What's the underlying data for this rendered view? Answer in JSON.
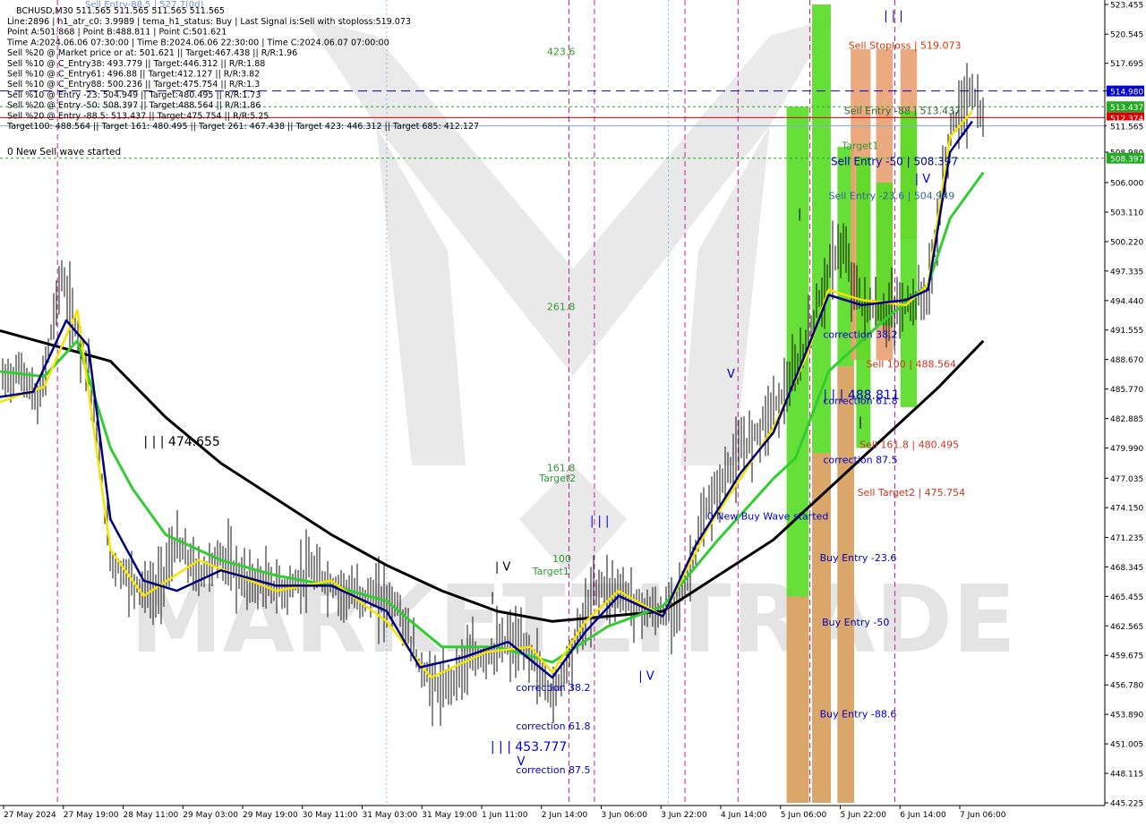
{
  "header": {
    "symbol_line": "BCHUSD,M30  511.565 511.565 511.565 511.565",
    "faded_line": "Sell Entry-88.5 | 527.7(0d)",
    "info_lines": [
      "Line:2896  |  h1_atr_c0: 3.9989  |  tema_h1_status: Buy  |  Last Signal is:Sell with stoploss:519.073",
      "Point A:501.868  |  Point B:488.811  |  Point C:501.621",
      "Time A:2024.06.06 07:30:00  |  Time B:2024.06.06 22:30:00  |  Time C:2024.06.07 07:00:00",
      "Sell %20 @ Market price or at: 501.621  ||  Target:467.438  ||  R/R:1.96",
      "Sell %10 @ C_Entry38: 493.779  ||  Target:446.312  ||  R/R:1.88",
      "Sell %10 @ C_Entry61: 496.88  ||  Target:412.127  ||  R/R:3.82",
      "Sell %10 @ C_Entry88: 500.236  ||  Target:475.754  ||  R/R:1.3",
      "Sell %10 @ Entry -23: 504.949  ||  Target:480.495  ||  R/R:1.73",
      "Sell %20 @ Entry -50: 508.397  ||  Target:488.564  ||  R/R:1.86",
      "Sell %20 @ Entry -88.5: 513.437  ||  Target:475.754  ||  R/R:5.25",
      "Target100: 488.564  ||  Target 161: 480.495  ||  Target 261: 467.438  ||  Target 423: 446.312  ||  Target 685: 412.127"
    ],
    "wave_status": "0 New Sell wave started"
  },
  "watermark": "MARKETZITRADE",
  "chart_data": {
    "type": "line",
    "symbol": "BCHUSD",
    "timeframe": "M30",
    "ylim": [
      445.225,
      523.455
    ],
    "y_ticks": [
      "523.455",
      "520.545",
      "517.695",
      "514.980",
      "511.565",
      "508.980",
      "506.000",
      "503.110",
      "500.220",
      "497.335",
      "494.440",
      "491.555",
      "488.670",
      "485.770",
      "482.885",
      "479.990",
      "477.035",
      "474.150",
      "471.235",
      "468.345",
      "465.455",
      "462.565",
      "459.675",
      "456.780",
      "453.890",
      "451.005",
      "448.115",
      "445.225"
    ],
    "x_ticks": [
      "27 May 2024",
      "27 May 19:00",
      "28 May 11:00",
      "29 May 03:00",
      "29 May 19:00",
      "30 May 11:00",
      "31 May 03:00",
      "31 May 19:00",
      "1 Jun 11:00",
      "2 Jun 14:00",
      "3 Jun 06:00",
      "3 Jun 22:00",
      "4 Jun 14:00",
      "5 Jun 06:00",
      "5 Jun 22:00",
      "6 Jun 14:00",
      "7 Jun 06:00"
    ],
    "price_path": [
      [
        0,
        486.5
      ],
      [
        0.02,
        487.5
      ],
      [
        0.035,
        484.0
      ],
      [
        0.055,
        497.0
      ],
      [
        0.065,
        493.0
      ],
      [
        0.08,
        488.0
      ],
      [
        0.1,
        469.0
      ],
      [
        0.12,
        467.0
      ],
      [
        0.14,
        465.5
      ],
      [
        0.16,
        470.5
      ],
      [
        0.18,
        467.5
      ],
      [
        0.2,
        469.5
      ],
      [
        0.22,
        467.0
      ],
      [
        0.24,
        466.5
      ],
      [
        0.26,
        466.0
      ],
      [
        0.28,
        468.0
      ],
      [
        0.3,
        466.5
      ],
      [
        0.32,
        465.5
      ],
      [
        0.34,
        465.5
      ],
      [
        0.36,
        464.5
      ],
      [
        0.38,
        458.5
      ],
      [
        0.4,
        456.0
      ],
      [
        0.42,
        459.0
      ],
      [
        0.44,
        459.5
      ],
      [
        0.46,
        461.0
      ],
      [
        0.48,
        460.0
      ],
      [
        0.5,
        455.5
      ],
      [
        0.52,
        461.0
      ],
      [
        0.54,
        466.5
      ],
      [
        0.56,
        466.0
      ],
      [
        0.58,
        464.5
      ],
      [
        0.6,
        463.5
      ],
      [
        0.62,
        466.5
      ],
      [
        0.64,
        474.0
      ],
      [
        0.66,
        478.0
      ],
      [
        0.68,
        481.0
      ],
      [
        0.7,
        484.0
      ],
      [
        0.72,
        487.0
      ],
      [
        0.74,
        494.0
      ],
      [
        0.76,
        500.0
      ],
      [
        0.78,
        494.0
      ],
      [
        0.8,
        493.0
      ],
      [
        0.82,
        494.0
      ],
      [
        0.84,
        495.0
      ],
      [
        0.86,
        511.0
      ],
      [
        0.88,
        515.0
      ],
      [
        0.89,
        511.5
      ]
    ],
    "ma_black": [
      [
        0,
        491.5
      ],
      [
        0.05,
        490.0
      ],
      [
        0.1,
        488.5
      ],
      [
        0.15,
        483.0
      ],
      [
        0.2,
        478.5
      ],
      [
        0.25,
        475.0
      ],
      [
        0.3,
        471.5
      ],
      [
        0.35,
        468.5
      ],
      [
        0.4,
        466.0
      ],
      [
        0.45,
        464.0
      ],
      [
        0.5,
        463.0
      ],
      [
        0.55,
        463.5
      ],
      [
        0.6,
        464.0
      ],
      [
        0.65,
        467.5
      ],
      [
        0.7,
        471.0
      ],
      [
        0.75,
        476.0
      ],
      [
        0.8,
        481.0
      ],
      [
        0.85,
        486.0
      ],
      [
        0.89,
        490.5
      ]
    ],
    "ma_green": [
      [
        0,
        487.5
      ],
      [
        0.04,
        487.0
      ],
      [
        0.07,
        490.5
      ],
      [
        0.1,
        480.0
      ],
      [
        0.12,
        476.0
      ],
      [
        0.15,
        471.5
      ],
      [
        0.2,
        469.0
      ],
      [
        0.25,
        467.5
      ],
      [
        0.3,
        466.5
      ],
      [
        0.35,
        465.0
      ],
      [
        0.4,
        460.5
      ],
      [
        0.45,
        460.5
      ],
      [
        0.5,
        459.0
      ],
      [
        0.55,
        462.5
      ],
      [
        0.6,
        464.5
      ],
      [
        0.65,
        471.0
      ],
      [
        0.7,
        477.0
      ],
      [
        0.72,
        479.0
      ],
      [
        0.75,
        487.5
      ],
      [
        0.8,
        492.5
      ],
      [
        0.84,
        496.0
      ],
      [
        0.86,
        502.5
      ],
      [
        0.89,
        507.0
      ]
    ],
    "ma_navy": [
      [
        0,
        485.0
      ],
      [
        0.03,
        485.5
      ],
      [
        0.06,
        492.5
      ],
      [
        0.08,
        490.0
      ],
      [
        0.1,
        473.0
      ],
      [
        0.13,
        467.0
      ],
      [
        0.16,
        466.0
      ],
      [
        0.2,
        468.0
      ],
      [
        0.25,
        466.5
      ],
      [
        0.3,
        466.5
      ],
      [
        0.35,
        464.0
      ],
      [
        0.38,
        458.5
      ],
      [
        0.42,
        459.5
      ],
      [
        0.46,
        461.0
      ],
      [
        0.5,
        457.5
      ],
      [
        0.53,
        462.0
      ],
      [
        0.56,
        465.5
      ],
      [
        0.6,
        463.5
      ],
      [
        0.63,
        470.5
      ],
      [
        0.67,
        477.5
      ],
      [
        0.7,
        481.5
      ],
      [
        0.73,
        489.5
      ],
      [
        0.75,
        495.0
      ],
      [
        0.78,
        494.0
      ],
      [
        0.82,
        494.5
      ],
      [
        0.84,
        495.5
      ],
      [
        0.86,
        509.0
      ],
      [
        0.88,
        512.0
      ]
    ],
    "ma_yellow": [
      [
        0,
        484.5
      ],
      [
        0.04,
        486.0
      ],
      [
        0.07,
        493.5
      ],
      [
        0.1,
        470.0
      ],
      [
        0.13,
        465.5
      ],
      [
        0.18,
        469.0
      ],
      [
        0.25,
        466.0
      ],
      [
        0.3,
        467.0
      ],
      [
        0.35,
        463.0
      ],
      [
        0.39,
        457.5
      ],
      [
        0.44,
        460.0
      ],
      [
        0.48,
        460.5
      ],
      [
        0.5,
        458.0
      ],
      [
        0.53,
        463.0
      ],
      [
        0.56,
        466.0
      ],
      [
        0.6,
        463.5
      ],
      [
        0.64,
        472.0
      ],
      [
        0.7,
        482.0
      ],
      [
        0.73,
        489.0
      ],
      [
        0.75,
        495.5
      ],
      [
        0.78,
        494.5
      ],
      [
        0.82,
        494.0
      ],
      [
        0.84,
        496.0
      ],
      [
        0.86,
        510.5
      ],
      [
        0.88,
        513.0
      ]
    ],
    "v_lines_magenta": [
      0.052,
      0.515,
      0.538,
      0.62,
      0.668,
      0.733,
      0.81
    ],
    "v_lines_lightblue": [
      0.35,
      0.605
    ],
    "h_lines": [
      {
        "value": 514.98,
        "color": "#0000cc",
        "style": "dashed",
        "label": "514.980"
      },
      {
        "value": 513.437,
        "color": "#22aa22",
        "style": "dotted",
        "label": "513.437"
      },
      {
        "value": 512.374,
        "color": "#dd0000",
        "style": "solid",
        "label": "512.374"
      },
      {
        "value": 511.565,
        "color": "#88aacc",
        "style": "solid",
        "label": "511.565"
      },
      {
        "value": 508.397,
        "color": "#22aa22",
        "style": "dotted",
        "label": "508.397"
      }
    ],
    "zones": [
      {
        "x0": 0.712,
        "x1": 0.732,
        "y0": 445.225,
        "y1": 513.437,
        "color": "#55dd22"
      },
      {
        "x0": 0.712,
        "x1": 0.732,
        "y0": 445.225,
        "y1": 465.455,
        "color": "#e8a070"
      },
      {
        "x0": 0.735,
        "x1": 0.752,
        "y0": 445.225,
        "y1": 523.455,
        "color": "#55dd22"
      },
      {
        "x0": 0.735,
        "x1": 0.752,
        "y0": 445.225,
        "y1": 479.5,
        "color": "#e8a070"
      },
      {
        "x0": 0.758,
        "x1": 0.773,
        "y0": 445.225,
        "y1": 509.5,
        "color": "#55dd22"
      },
      {
        "x0": 0.758,
        "x1": 0.773,
        "y0": 445.225,
        "y1": 488.0,
        "color": "#e8a070"
      },
      {
        "x0": 0.77,
        "x1": 0.788,
        "y0": 488.6,
        "y1": 519.073,
        "color": "#e8a070"
      },
      {
        "x0": 0.775,
        "x1": 0.788,
        "y0": 480.0,
        "y1": 508.5,
        "color": "#55dd22"
      },
      {
        "x0": 0.793,
        "x1": 0.808,
        "y0": 488.6,
        "y1": 519.073,
        "color": "#e8a070"
      },
      {
        "x0": 0.793,
        "x1": 0.808,
        "y0": 492.0,
        "y1": 506.0,
        "color": "#55dd22"
      },
      {
        "x0": 0.815,
        "x1": 0.83,
        "y0": 500.5,
        "y1": 519.073,
        "color": "#e8a070"
      },
      {
        "x0": 0.815,
        "x1": 0.83,
        "y0": 484.0,
        "y1": 513.0,
        "color": "#55dd22"
      }
    ],
    "annotations": [
      {
        "text": "423.6",
        "x": 0.495,
        "y": 518.5,
        "color": "#339933"
      },
      {
        "text": "261.8",
        "x": 0.495,
        "y": 493.5,
        "color": "#339933"
      },
      {
        "text": "161.8",
        "x": 0.495,
        "y": 477.7,
        "color": "#339933"
      },
      {
        "text": "Target2",
        "x": 0.488,
        "y": 476.7,
        "color": "#339933"
      },
      {
        "text": "100",
        "x": 0.5,
        "y": 468.8,
        "color": "#339933"
      },
      {
        "text": "Target1",
        "x": 0.482,
        "y": 467.6,
        "color": "#339933"
      },
      {
        "text": "| | | 474.655",
        "x": 0.13,
        "y": 480.2,
        "color": "#000000",
        "size": 14
      },
      {
        "text": "| V",
        "x": 0.448,
        "y": 468.0,
        "color": "#000000",
        "size": 13
      },
      {
        "text": "|",
        "x": 0.444,
        "y": 465.0,
        "color": "#000000",
        "size": 13
      },
      {
        "text": "| | |",
        "x": 0.534,
        "y": 472.5,
        "color": "#0000cc",
        "size": 13
      },
      {
        "text": "| V",
        "x": 0.578,
        "y": 457.3,
        "color": "#0000cc",
        "size": 13
      },
      {
        "text": "V",
        "x": 0.658,
        "y": 486.9,
        "color": "#0000cc",
        "size": 13
      },
      {
        "text": "| | | 453.777",
        "x": 0.444,
        "y": 450.3,
        "color": "#0000cc",
        "size": 14
      },
      {
        "text": "V",
        "x": 0.468,
        "y": 448.9,
        "color": "#0000cc",
        "size": 13
      },
      {
        "text": "correction 38.2",
        "x": 0.467,
        "y": 456.2,
        "color": "#0000cc"
      },
      {
        "text": "correction 61.8",
        "x": 0.467,
        "y": 452.4,
        "color": "#0000cc"
      },
      {
        "text": "correction 87.5",
        "x": 0.467,
        "y": 448.1,
        "color": "#0000cc"
      },
      {
        "text": "0 New Buy Wave started",
        "x": 0.64,
        "y": 473.0,
        "color": "#0000cc"
      },
      {
        "text": "| | | 488.811",
        "x": 0.745,
        "y": 484.8,
        "color": "#0000cc",
        "size": 14
      },
      {
        "text": "correction 61.8",
        "x": 0.745,
        "y": 484.3,
        "color": "#0000cc"
      },
      {
        "text": "correction 87.5",
        "x": 0.745,
        "y": 478.5,
        "color": "#0000cc"
      },
      {
        "text": "correction 38.2",
        "x": 0.745,
        "y": 490.8,
        "color": "#0000cc"
      },
      {
        "text": "|",
        "x": 0.777,
        "y": 482.2,
        "color": "#000000",
        "size": 13
      },
      {
        "text": "|",
        "x": 0.722,
        "y": 502.6,
        "color": "#000000",
        "size": 13
      },
      {
        "text": "| | |",
        "x": 0.8,
        "y": 522.0,
        "color": "#0000cc",
        "size": 13
      },
      {
        "text": "| V",
        "x": 0.828,
        "y": 506.0,
        "color": "#0000cc",
        "size": 13
      },
      {
        "text": "Sell Stoploss | 519.073",
        "x": 0.768,
        "y": 519.1,
        "color": "#dd3300"
      },
      {
        "text": "Sell Entry -88 | 513.437",
        "x": 0.764,
        "y": 512.7,
        "color": "#336633"
      },
      {
        "text": "Target1",
        "x": 0.762,
        "y": 509.3,
        "color": "#339933"
      },
      {
        "text": "Sell Entry -50 | 508.397",
        "x": 0.752,
        "y": 507.7,
        "color": "#0000aa",
        "size": 12
      },
      {
        "text": "Sell Entry -23.6 | 504.949",
        "x": 0.75,
        "y": 504.4,
        "color": "#336699"
      },
      {
        "text": "Sell 100 | 488.564",
        "x": 0.784,
        "y": 487.9,
        "color": "#cc3322"
      },
      {
        "text": "Sell 161.8 | 480.495",
        "x": 0.778,
        "y": 480.0,
        "color": "#cc3322"
      },
      {
        "text": "Sell Target2 | 475.754",
        "x": 0.776,
        "y": 475.3,
        "color": "#cc3322"
      },
      {
        "text": "Buy Entry -23.6",
        "x": 0.742,
        "y": 468.9,
        "color": "#0000cc"
      },
      {
        "text": "Buy Entry -50",
        "x": 0.744,
        "y": 462.6,
        "color": "#0000cc"
      },
      {
        "text": "Buy Entry -88.6",
        "x": 0.742,
        "y": 453.6,
        "color": "#0000cc"
      }
    ]
  }
}
